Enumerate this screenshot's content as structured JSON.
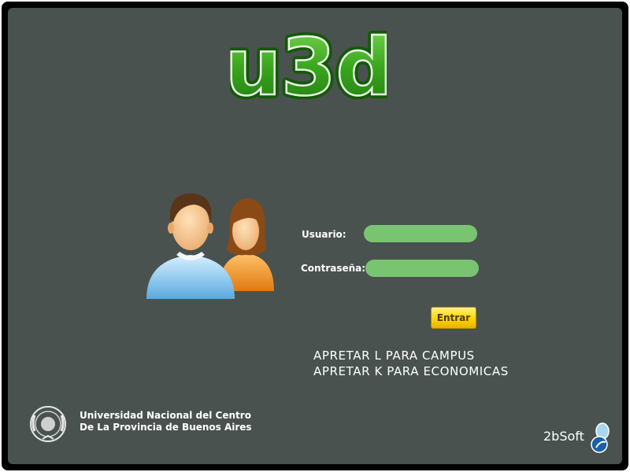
{
  "logo": {
    "text": "u3d"
  },
  "login": {
    "user_label": "Usuario:",
    "user_value": "",
    "password_label": "Contraseña:",
    "password_value": "",
    "submit_label": "Entrar"
  },
  "hints": [
    "APRETAR L PARA CAMPUS",
    "APRETAR K PARA ECONOMICAS"
  ],
  "university": {
    "line1": "Universidad Nacional del Centro",
    "line2": "De La Provincia de Buenos Aires"
  },
  "brand": {
    "name": "2bSoft"
  },
  "icons": {
    "users": "users-icon",
    "seal": "university-seal-icon",
    "brand_mark": "2bsoft-logo-icon"
  },
  "colors": {
    "background": "#4a524f",
    "frame": "#000000",
    "logo_green": "#3aa51d",
    "field_green": "#79c471",
    "button_yellow": "#ffd400",
    "text": "#ffffff"
  }
}
